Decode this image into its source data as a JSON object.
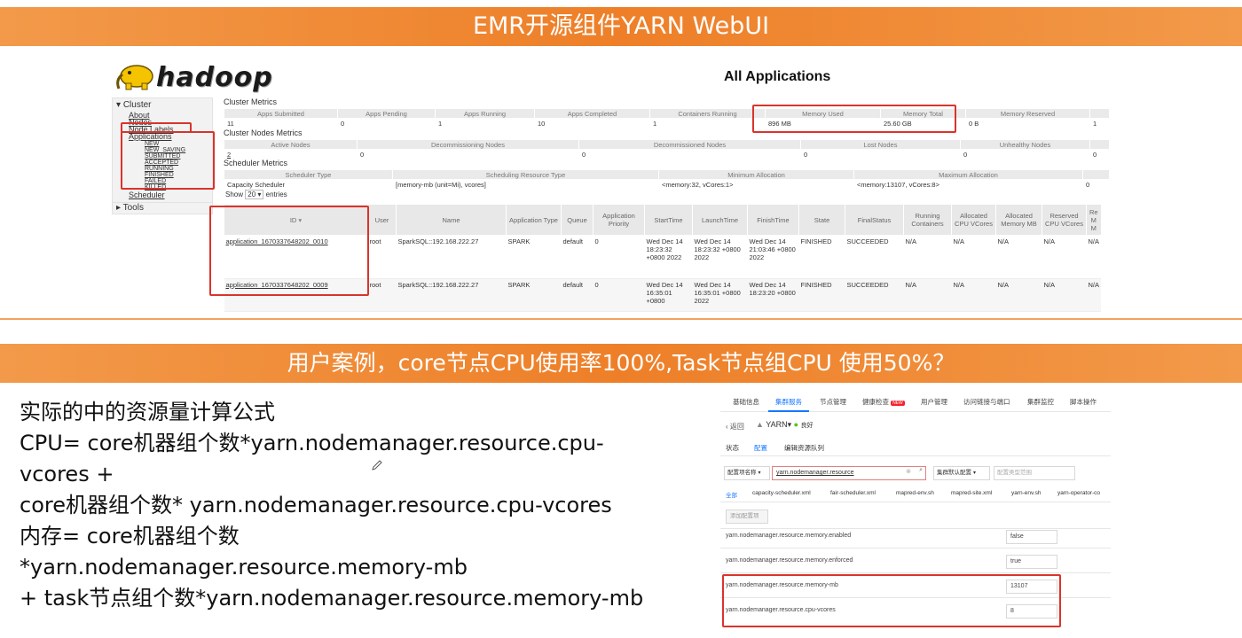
{
  "banner_top": "EMR开源组件YARN WebUI",
  "banner_bottom": "用户案例，core节点CPU使用率100%,Task节点组CPU 使用50%？",
  "hadoop": {
    "logo_text": "hadoop",
    "title": "All Applications",
    "sidebar": {
      "cluster": "Cluster",
      "about": "About",
      "nodes": "Nodes",
      "node_labels": "Node Labels",
      "applications": "Applications",
      "states": [
        "NEW",
        "NEW_SAVING",
        "SUBMITTED",
        "ACCEPTED",
        "RUNNING",
        "FINISHED",
        "FAILED",
        "KILLED"
      ],
      "scheduler": "Scheduler",
      "tools": "Tools"
    },
    "cluster_metrics": {
      "label": "Cluster Metrics",
      "headers": [
        "Apps Submitted",
        "Apps Pending",
        "Apps Running",
        "Apps Completed",
        "Containers Running",
        "Memory Used",
        "Memory Total",
        "Memory Reserved"
      ],
      "values": [
        "11",
        "0",
        "1",
        "10",
        "1",
        "896 MB",
        "25.60 GB",
        "0 B",
        "1"
      ]
    },
    "nodes_metrics": {
      "label": "Cluster Nodes Metrics",
      "headers": [
        "Active Nodes",
        "Decommissioning Nodes",
        "Decommissioned Nodes",
        "Lost Nodes",
        "Unhealthy Nodes"
      ],
      "values": [
        "2",
        "0",
        "0",
        "0",
        "0",
        "0"
      ]
    },
    "scheduler_metrics": {
      "label": "Scheduler Metrics",
      "headers": [
        "Scheduler Type",
        "Scheduling Resource Type",
        "Minimum Allocation",
        "Maximum Allocation"
      ],
      "values": [
        "Capacity Scheduler",
        "[memory-mb (unit=Mi), vcores]",
        "<memory:32, vCores:1>",
        "<memory:13107, vCores:8>",
        "0"
      ]
    },
    "show_entries": {
      "pre": "Show",
      "value": "20",
      "post": "entries"
    },
    "apps_headers": [
      "ID",
      "User",
      "Name",
      "Application Type",
      "Queue",
      "Application Priority",
      "StartTime",
      "LaunchTime",
      "FinishTime",
      "State",
      "FinalStatus",
      "Running Containers",
      "Allocated CPU VCores",
      "Allocated Memory MB",
      "Reserved CPU VCores",
      "Re M M"
    ],
    "apps": [
      {
        "id": "application_1670337648202_0010",
        "user": "root",
        "name": "SparkSQL::192.168.222.27",
        "type": "SPARK",
        "queue": "default",
        "priority": "0",
        "start": "Wed Dec 14 18:23:32 +0800 2022",
        "launch": "Wed Dec 14 18:23:32 +0800 2022",
        "finish": "Wed Dec 14 21:03:46 +0800 2022",
        "state": "FINISHED",
        "final": "SUCCEEDED",
        "rc": "N/A",
        "acpu": "N/A",
        "amem": "N/A",
        "rcpu": "N/A",
        "rm": "N/A"
      },
      {
        "id": "application_1670337648202_0009",
        "user": "root",
        "name": "SparkSQL::192.168.222.27",
        "type": "SPARK",
        "queue": "default",
        "priority": "0",
        "start": "Wed Dec 14 16:35:01 +0800",
        "launch": "Wed Dec 14 16:35:01 +0800 2022",
        "finish": "Wed Dec 14 18:23:20 +0800",
        "state": "FINISHED",
        "final": "SUCCEEDED",
        "rc": "N/A",
        "acpu": "N/A",
        "amem": "N/A",
        "rcpu": "N/A",
        "rm": "N/A"
      }
    ]
  },
  "formula": {
    "l1": "实际的中的资源量计算公式",
    "l2": "CPU= core机器组个数*yarn.nodemanager.resource.cpu-",
    "l3": "vcores +",
    "l4": "core机器组个数* yarn.nodemanager.resource.cpu-vcores",
    "l5": "内存= core机器组个数",
    "l6": "*yarn.nodemanager.resource.memory-mb",
    "l7": "+ task节点组个数*yarn.nodemanager.resource.memory-mb"
  },
  "console": {
    "tabs": [
      "基础信息",
      "集群服务",
      "节点管理",
      "健康检查",
      "用户管理",
      "访问链接与端口",
      "集群监控",
      "脚本操作"
    ],
    "active_tab": "集群服务",
    "health_badge": "NEW",
    "back": "返回",
    "service": "YARN",
    "status": "良好",
    "subtabs": [
      "状态",
      "配置",
      "编辑资源队列"
    ],
    "active_subtab": "配置",
    "filter_select": "配置项名称",
    "search_value": "yarn.nodemanager.resource",
    "scope_select": "集群默认配置",
    "range_placeholder": "配置类型范围",
    "file_tabs": [
      "全部",
      "capacity-scheduler.xml",
      "fair-scheduler.xml",
      "mapred-env.sh",
      "mapred-site.xml",
      "yarn-env.sh",
      "yarn-operator-co"
    ],
    "add_button": "添加配置项",
    "props": [
      {
        "name": "yarn.nodemanager.resource.memory.enabled",
        "value": "false"
      },
      {
        "name": "yarn.nodemanager.resource.memory.enforced",
        "value": "true"
      },
      {
        "name": "yarn.nodemanager.resource.memory-mb",
        "value": "13107"
      },
      {
        "name": "yarn.nodemanager.resource.cpu-vcores",
        "value": "8"
      }
    ]
  },
  "colors": {
    "banner": "#ee7f28",
    "highlight": "#d9342b",
    "link": "#1677ff"
  }
}
